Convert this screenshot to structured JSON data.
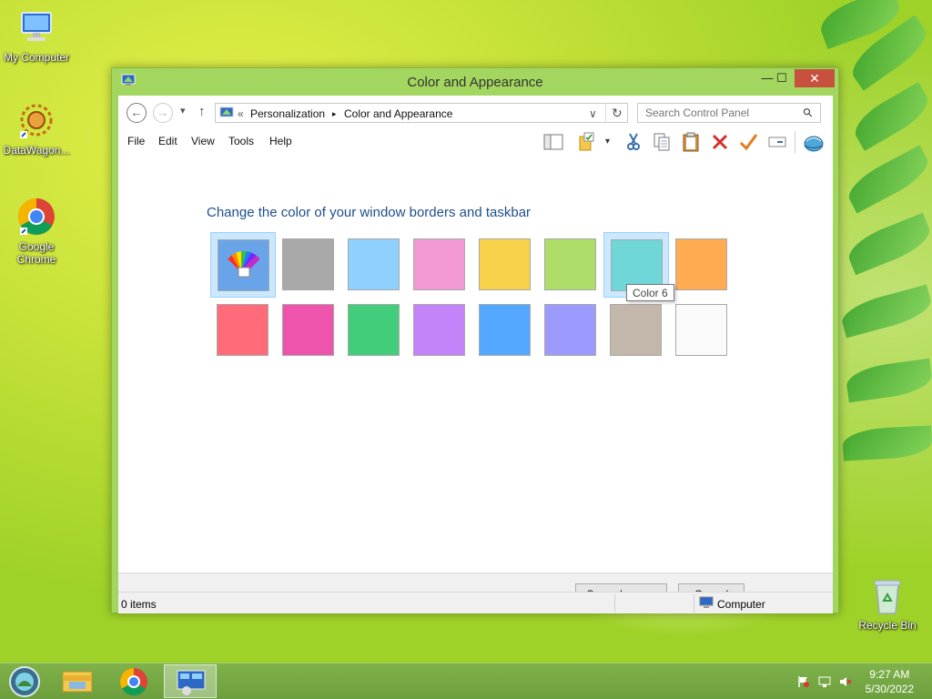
{
  "desktop": {
    "icons": [
      {
        "label": "My Computer"
      },
      {
        "label": "DataWagon..."
      },
      {
        "label": "Google Chrome"
      },
      {
        "label": "Recycle Bin"
      }
    ]
  },
  "window": {
    "title": "Color and Appearance",
    "controls": {
      "minimize": "—",
      "maximize": "☐",
      "close": "✕"
    }
  },
  "navbar": {
    "back": "←",
    "forward": "→",
    "recent": "▾",
    "up": "↑",
    "breadcrumb_prefix": "«",
    "breadcrumb": [
      "Personalization",
      "Color and Appearance"
    ],
    "breadcrumb_sep": "▸",
    "dropdown": "∨",
    "refresh": "↻",
    "search_placeholder": "Search Control Panel",
    "search_icon": "⚲"
  },
  "menu": {
    "items": [
      "File",
      "Edit",
      "View",
      "Tools",
      "Help"
    ]
  },
  "content": {
    "heading": "Change the color of your window borders and taskbar",
    "tooltip": "Color 6",
    "swatches_row1": [
      {
        "name": "custom-color-mixer",
        "color": "#6aa4e8"
      },
      {
        "name": "color-1",
        "color": "#a9a9a9"
      },
      {
        "name": "color-2",
        "color": "#8fd0ff"
      },
      {
        "name": "color-3",
        "color": "#f39ad4"
      },
      {
        "name": "color-4",
        "color": "#f7d14a"
      },
      {
        "name": "color-5",
        "color": "#aedd69"
      },
      {
        "name": "color-6",
        "color": "#6fd7d8"
      },
      {
        "name": "color-7",
        "color": "#ffab52"
      }
    ],
    "swatches_row2": [
      {
        "name": "color-8",
        "color": "#ff6b78"
      },
      {
        "name": "color-9",
        "color": "#ee54ab"
      },
      {
        "name": "color-10",
        "color": "#41cd7a"
      },
      {
        "name": "color-11",
        "color": "#c284f8"
      },
      {
        "name": "color-12",
        "color": "#55a8ff"
      },
      {
        "name": "color-13",
        "color": "#9c9bfd"
      },
      {
        "name": "color-14",
        "color": "#c3b6ab"
      },
      {
        "name": "color-15",
        "color": "#fafafa"
      }
    ]
  },
  "footer": {
    "save_label": "Save changes",
    "cancel_label": "Cancel"
  },
  "status": {
    "items": "0 items",
    "location": "Computer"
  },
  "taskbar": {
    "time": "9:27 AM",
    "date": "5/30/2022"
  },
  "colors": {
    "window_frame": "#a3d65e",
    "heading": "#1e4e8c",
    "selection": "#cce8ff"
  }
}
